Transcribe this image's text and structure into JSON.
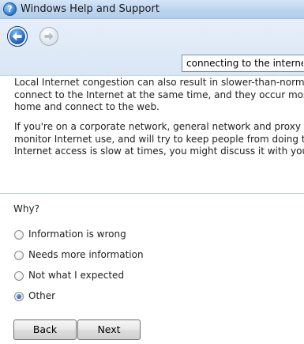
{
  "window": {
    "title": "Windows Help and Support",
    "icon": "help-globe-icon"
  },
  "toolbar": {
    "back_icon": "back-arrow-icon",
    "forward_icon": "forward-arrow-icon",
    "back_enabled": true,
    "forward_enabled": false,
    "search_value": "connecting to the internet"
  },
  "content": {
    "paragraph1": [
      "Local Internet congestion can also result in slower-than-normal conne",
      "connect to the Internet at the same time, and they occur most often a",
      "home and connect to the web."
    ],
    "paragraph2": [
      "If you're on a corporate network, general network and proxy server use",
      "monitor Internet use, and will try to keep people from doing things lik",
      "Internet access is slow at times, you might discuss it with your networ"
    ]
  },
  "feedback": {
    "question": "Why?",
    "options": [
      {
        "label": "Information is wrong",
        "checked": false
      },
      {
        "label": "Needs more information",
        "checked": false
      },
      {
        "label": "Not what I expected",
        "checked": false
      },
      {
        "label": "Other",
        "checked": true
      }
    ],
    "back_label": "Back",
    "next_label": "Next"
  },
  "colors": {
    "titlebar": "#bcd4ee",
    "toolbar": "#dfe9f5",
    "divider": "#b8c7d8",
    "back_button": "#1f63b6"
  }
}
